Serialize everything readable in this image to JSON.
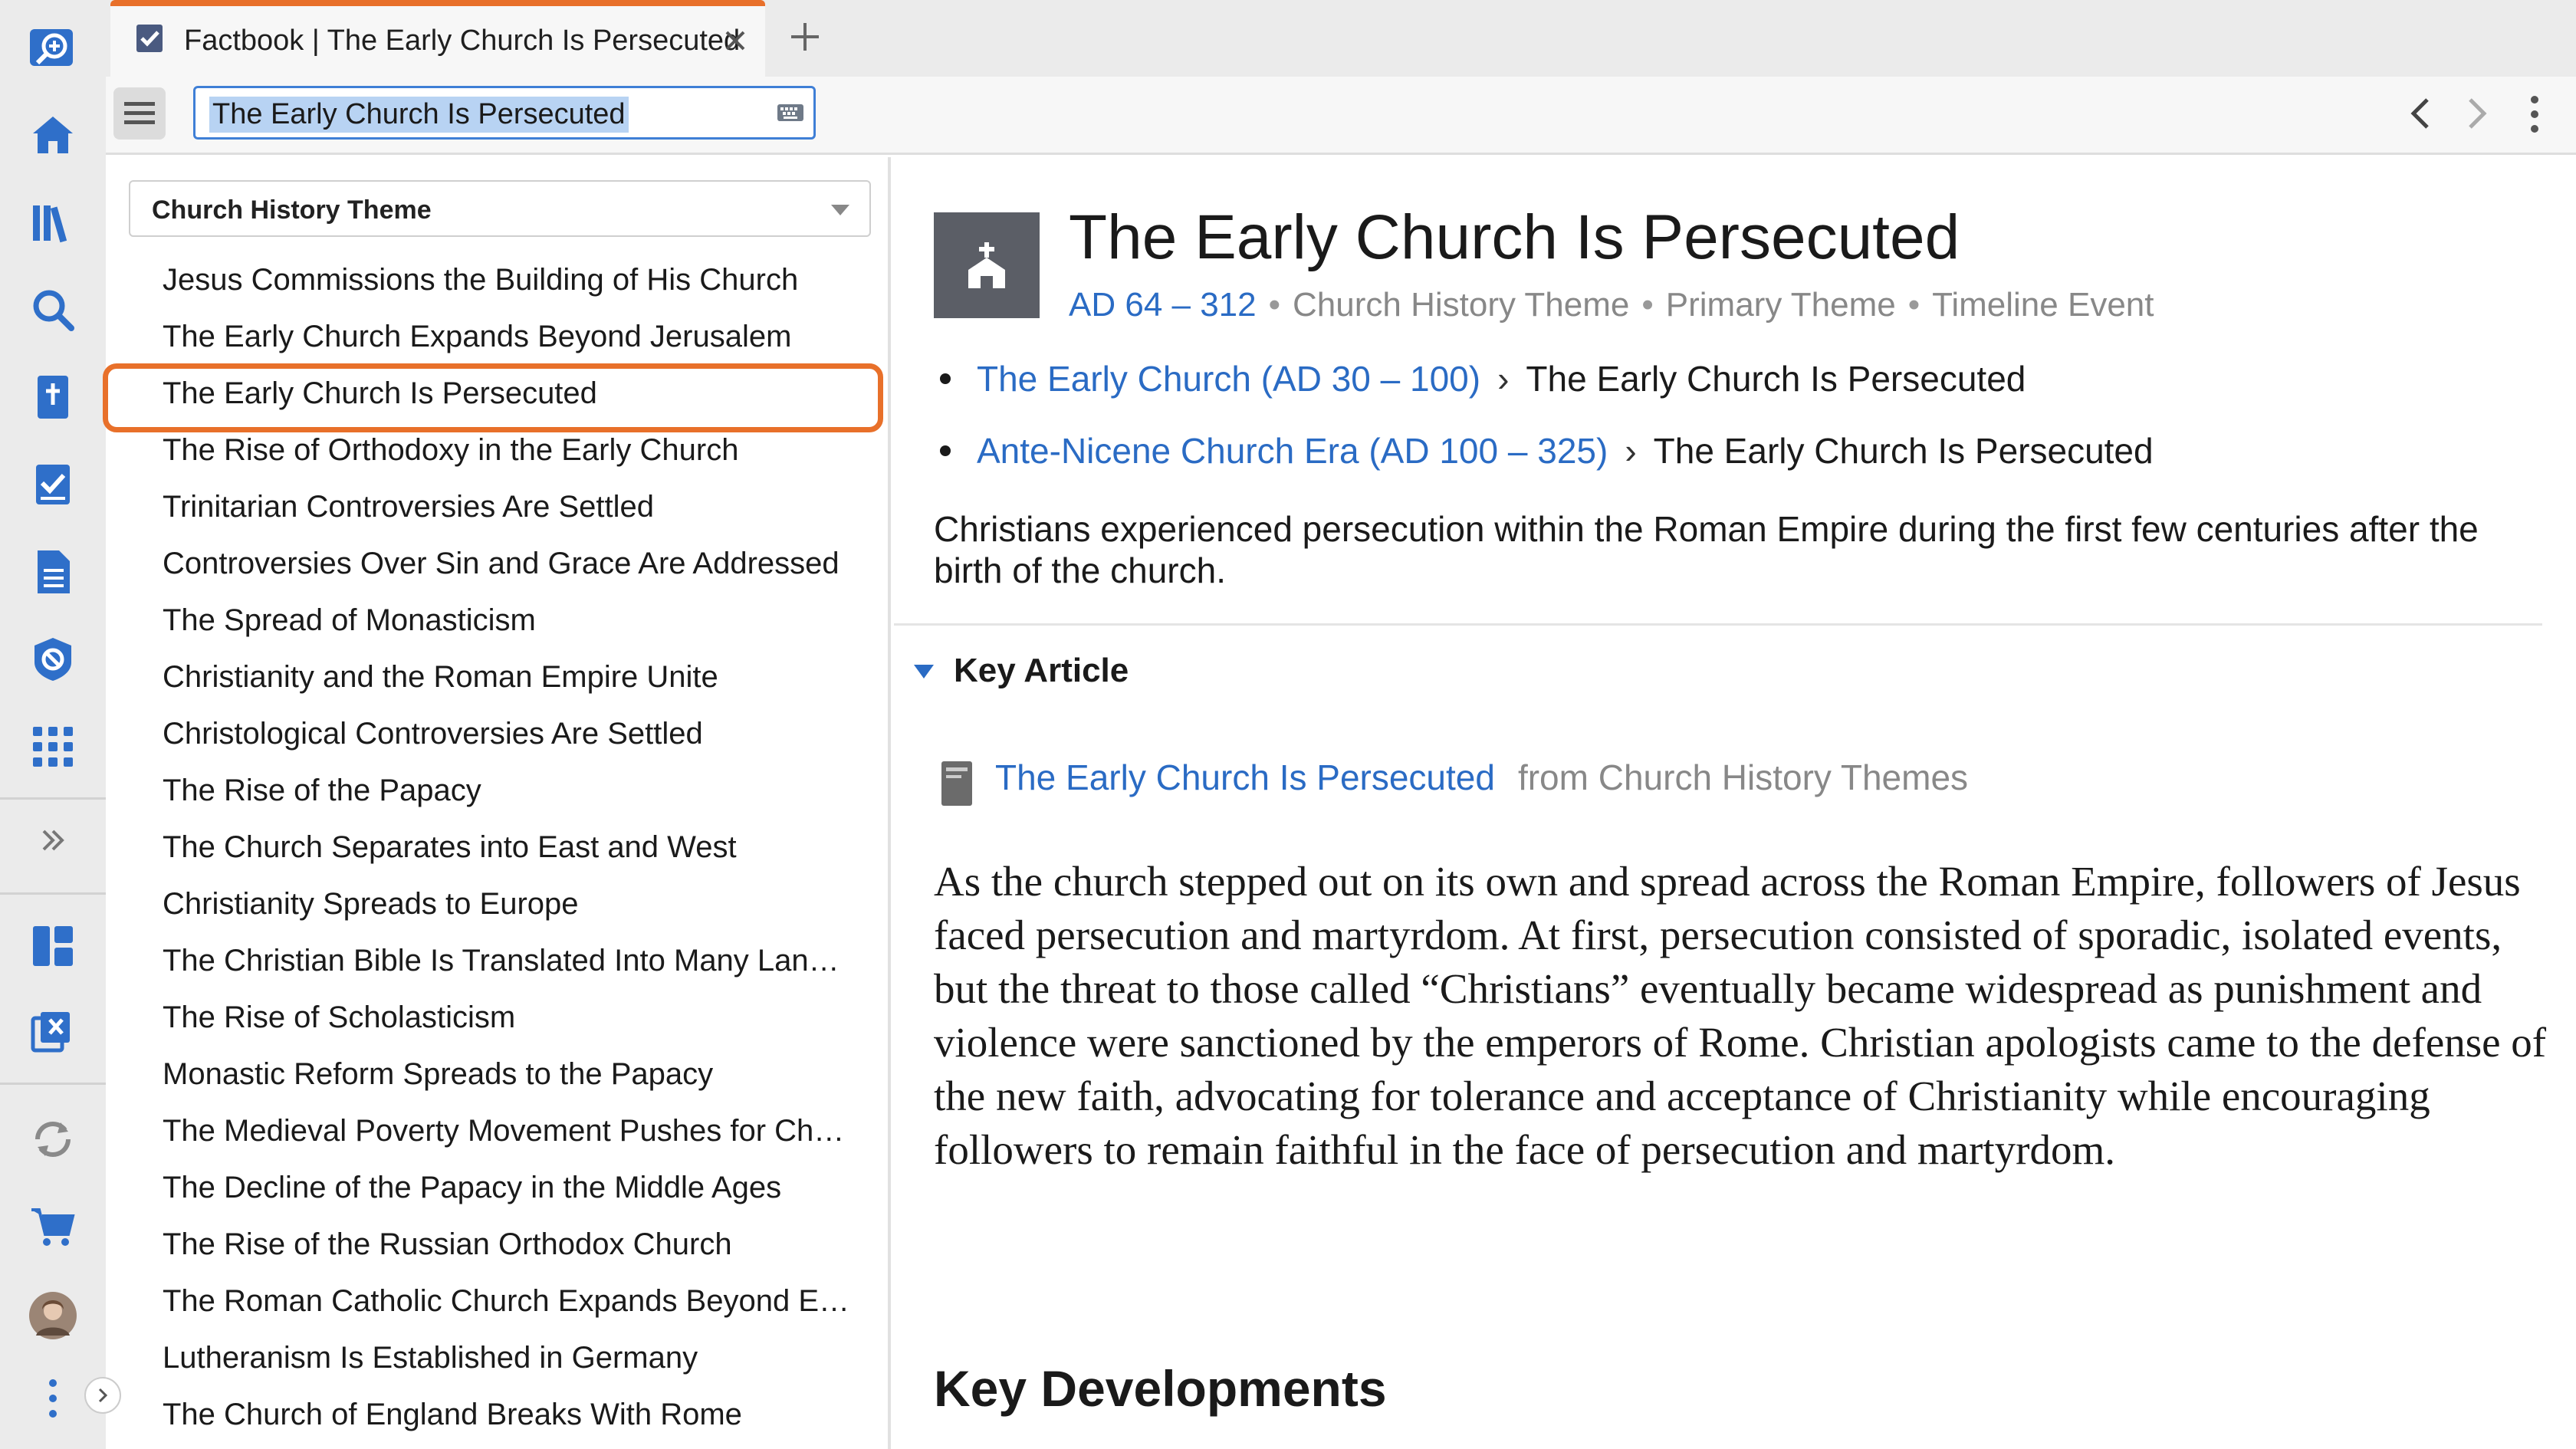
{
  "tab": {
    "title": "Factbook | The Early Church Is Persecuted",
    "icon": "checkbox-icon"
  },
  "toolbar": {
    "search_value": "The Early Church Is Persecuted"
  },
  "sidebar": {
    "icons": [
      "factbook-search-icon",
      "home-icon",
      "library-icon",
      "search-icon",
      "bible-icon",
      "checklist-icon",
      "document-icon",
      "atlas-icon",
      "apps-grid-icon",
      "expand-icon",
      "layouts-icon",
      "close-panels-icon",
      "sync-icon",
      "cart-icon",
      "avatar",
      "more-icon"
    ]
  },
  "left_panel": {
    "dropdown_label": "Church History Theme",
    "topics": [
      "Jesus Commissions the Building of His Church",
      "The Early Church Expands Beyond Jerusalem",
      "The Early Church Is Persecuted",
      "The Rise of Orthodoxy in the Early Church",
      "Trinitarian Controversies Are Settled",
      "Controversies Over Sin and Grace Are Addressed",
      "The Spread of Monasticism",
      "Christianity and the Roman Empire Unite",
      "Christological Controversies Are Settled",
      "The Rise of the Papacy",
      "The Church Separates into East and West",
      "Christianity Spreads to Europe",
      "The Christian Bible Is Translated Into Many Lan…",
      "The Rise of Scholasticism",
      "Monastic Reform Spreads to the Papacy",
      "The Medieval Poverty Movement Pushes for Ch…",
      "The Decline of the Papacy in the Middle Ages",
      "The Rise of the Russian Orthodox Church",
      "The Roman Catholic Church Expands Beyond E…",
      "Lutheranism Is Established in Germany",
      "The Church of England Breaks With Rome"
    ],
    "selected_index": 2
  },
  "article": {
    "title": "The Early Church Is Persecuted",
    "date_range": "AD 64 – 312",
    "meta": [
      "Church History Theme",
      "Primary Theme",
      "Timeline Event"
    ],
    "breadcrumbs": [
      {
        "parent": "The Early Church (AD 30 – 100)",
        "current": "The Early Church Is Persecuted"
      },
      {
        "parent": "Ante-Nicene Church Era (AD 100 – 325)",
        "current": "The Early Church Is Persecuted"
      }
    ],
    "summary": "Christians experienced persecution within the Roman Empire during the first few centuries after the birth of the church.",
    "key_article_heading": "Key Article",
    "key_article_link": "The Early Church Is Persecuted",
    "key_article_source": "from Church History Themes",
    "body": "As the church stepped out on its own and spread across the Roman Empire, followers of Jesus faced persecution and martyrdom. At first, persecution consisted of sporadic, isolated events, but the threat to those called “Christians” eventually became widespread as punishment and violence were sanctioned by the emperors of Rome. Christian apologists came to the defense of the new faith, advocating for tolerance and acceptance of Christianity while encouraging followers to remain faithful in the face of persecution and martyrdom.",
    "section_heading": "Key Developments"
  },
  "colors": {
    "accent_orange": "#e8702a",
    "link_blue": "#2a6bc4",
    "icon_blue": "#2f6fc9"
  }
}
